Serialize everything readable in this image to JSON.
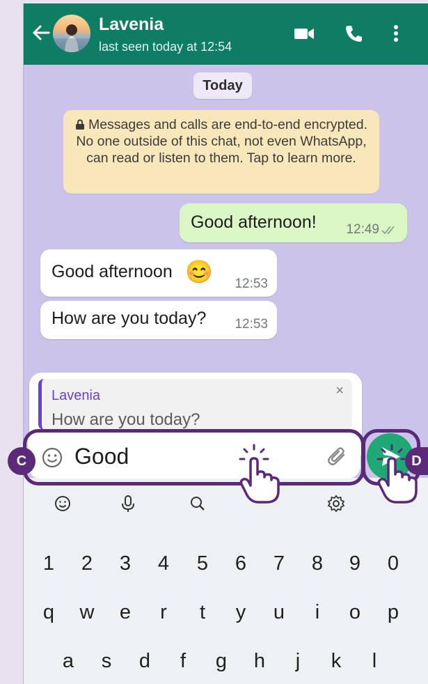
{
  "header": {
    "contact_name": "Lavenia",
    "status": "last seen today at 12:54",
    "icons": [
      "back-arrow-icon",
      "video-call-icon",
      "phone-icon",
      "more-vert-icon"
    ]
  },
  "chat": {
    "date_pill": "Today",
    "encryption_notice": "Messages and calls are end-to-end encrypted. No one outside of this chat, not even WhatsApp, can read or listen to them. Tap to learn more.",
    "messages": [
      {
        "direction": "out",
        "text": "Good afternoon!",
        "time": "12:49"
      },
      {
        "direction": "in",
        "text": "Good afternoon",
        "time": "12:53",
        "emoji": "😊"
      },
      {
        "direction": "in",
        "text": "How are you today?",
        "time": "12:53"
      }
    ]
  },
  "reply": {
    "name": "Lavenia",
    "text": "How are you today?",
    "close": "×"
  },
  "composer": {
    "value": "Good"
  },
  "badges": {
    "input_badge": "C",
    "send_badge": "D"
  },
  "keyboard": {
    "tools": [
      "emoji-icon",
      "mic-icon",
      "search-icon",
      "settings-icon"
    ],
    "number_row": [
      "1",
      "2",
      "3",
      "4",
      "5",
      "6",
      "7",
      "8",
      "9",
      "0"
    ],
    "row1": [
      "q",
      "w",
      "e",
      "r",
      "t",
      "y",
      "u",
      "i",
      "o",
      "p"
    ],
    "row2": [
      "a",
      "s",
      "d",
      "f",
      "g",
      "h",
      "j",
      "k",
      "l"
    ]
  },
  "colors": {
    "header": "#0e7d64",
    "chat_bg": "#cbc3ea",
    "outgoing_bubble": "#dbf7c5",
    "send_button": "#1fa774",
    "highlight": "#5a2a78"
  }
}
